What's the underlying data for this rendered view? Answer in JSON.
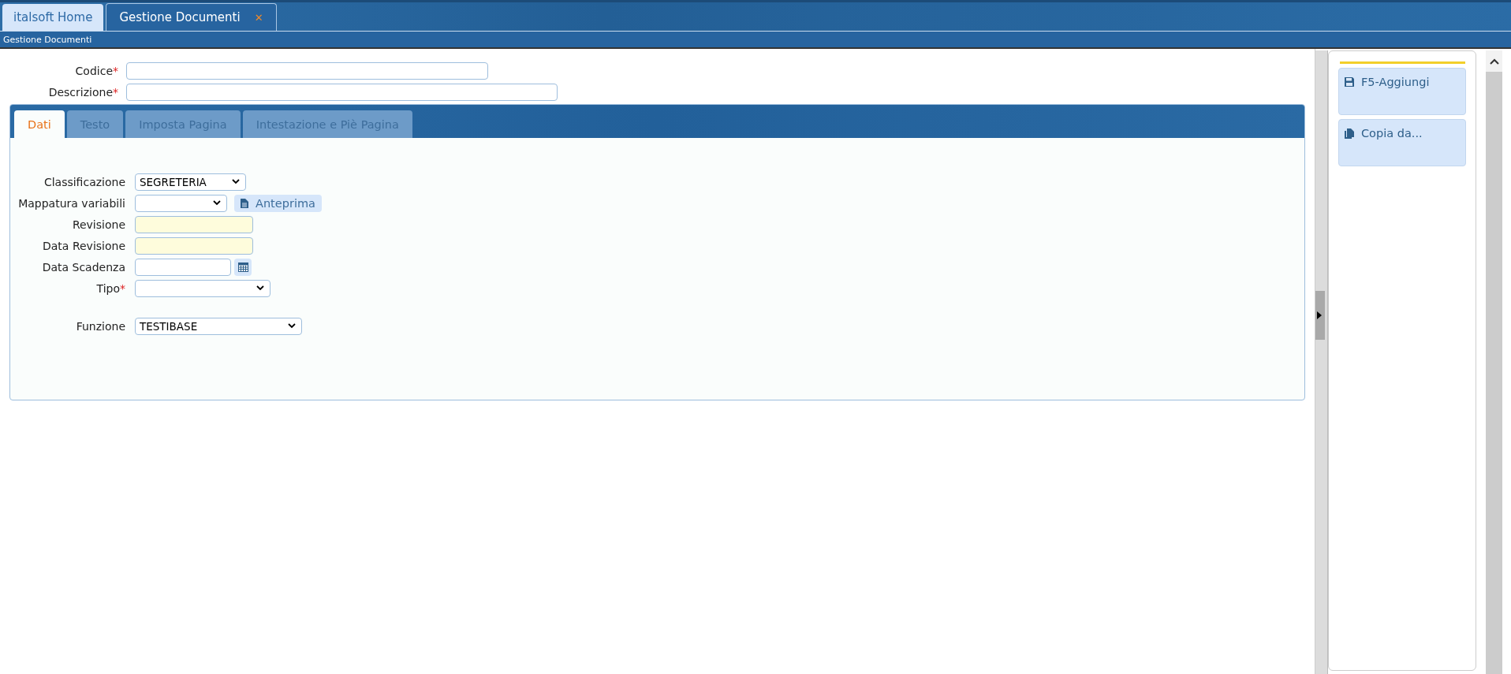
{
  "window_tabs": [
    {
      "label": "italsoft Home",
      "selected": false,
      "closable": false
    },
    {
      "label": "Gestione Documenti",
      "selected": true,
      "closable": true
    }
  ],
  "close_glyph": "✕",
  "required_mark": "*",
  "breadcrumb": "Gestione Documenti",
  "header_fields": [
    {
      "label": "Codice",
      "required": true
    },
    {
      "label": "Descrizione",
      "required": true
    }
  ],
  "tabs": [
    {
      "label": "Dati",
      "selected": true
    },
    {
      "label": "Testo",
      "selected": false
    },
    {
      "label": "Imposta Pagina",
      "selected": false
    },
    {
      "label": "Intestazione e Piè Pagina",
      "selected": false
    }
  ],
  "fields": [
    {
      "label": "Classificazione",
      "kind": "select",
      "value": "SEGRETERIA",
      "required": false,
      "readonly": false
    },
    {
      "label": "Mappatura variabili",
      "kind": "select",
      "required": false,
      "readonly": false,
      "button": "Anteprima"
    },
    {
      "label": "Revisione",
      "kind": "text",
      "required": false,
      "readonly": true
    },
    {
      "label": "Data Revisione",
      "kind": "text",
      "required": false,
      "readonly": true
    },
    {
      "label": "Data Scadenza",
      "kind": "date",
      "required": false,
      "readonly": false
    },
    {
      "label": "Tipo",
      "kind": "select",
      "required": true,
      "readonly": false
    }
  ],
  "funzione": {
    "label": "Funzione",
    "kind": "select",
    "value": "TESTIBASE",
    "required": false,
    "readonly": false
  },
  "actions": [
    {
      "label": "F5-Aggiungi",
      "kind": "save"
    },
    {
      "label": "Copia da...",
      "kind": "copy"
    }
  ]
}
